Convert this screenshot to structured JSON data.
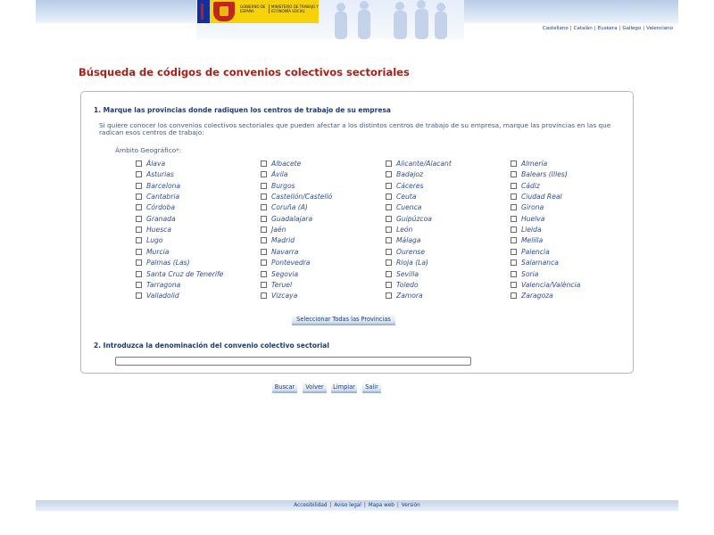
{
  "header": {
    "logo_gobierno": "GOBIERNO DE ESPAÑA",
    "logo_ministerio": "MINISTERIO DE TRABAJO Y ECONOMÍA SOCIAL",
    "languages": [
      "Castellano",
      "Catalán",
      "Euskera",
      "Gallego",
      "Valenciano"
    ]
  },
  "page_title": "Búsqueda de códigos de convenios colectivos sectoriales",
  "section1": {
    "heading": "1. Marque las provincias donde radiquen los centros de trabajo de su empresa",
    "intro": "Si quiere conocer los convenios colectivos sectoriales que pueden afectar a los distintos centros de trabajo de su empresa, marque las provincias en las que radican esos centros de trabajo:",
    "ambito_label": "Ámbito Geográfico*:",
    "provinces": [
      [
        "Álava",
        "Albacete",
        "Alicante/Alacant",
        "Almería"
      ],
      [
        "Asturias",
        "Ávila",
        "Badajoz",
        "Balears (Illes)"
      ],
      [
        "Barcelona",
        "Burgos",
        "Cáceres",
        "Cádiz"
      ],
      [
        "Cantabria",
        "Castellón/Castelló",
        "Ceuta",
        "Ciudad Real"
      ],
      [
        "Córdoba",
        "Coruña (A)",
        "Cuenca",
        "Girona"
      ],
      [
        "Granada",
        "Guadalajara",
        "Guipúzcoa",
        "Huelva"
      ],
      [
        "Huesca",
        "Jaén",
        "León",
        "Lleida"
      ],
      [
        "Lugo",
        "Madrid",
        "Málaga",
        "Melilla"
      ],
      [
        "Murcia",
        "Navarra",
        "Ourense",
        "Palencia"
      ],
      [
        "Palmas (Las)",
        "Pontevedra",
        "Rioja (La)",
        "Salamanca"
      ],
      [
        "Santa Cruz de Tenerife",
        "Segovia",
        "Sevilla",
        "Soria"
      ],
      [
        "Tarragona",
        "Teruel",
        "Toledo",
        "Valencia/València"
      ],
      [
        "Valladolid",
        "Vizcaya",
        "Zamora",
        "Zaragoza"
      ]
    ],
    "select_all_label": "Seleccionar Todas las Provincias"
  },
  "section2": {
    "heading": "2. Introduzca la denominación del convenio colectivo sectorial",
    "input_value": ""
  },
  "actions": {
    "buscar": "Buscar",
    "volver": "Volver",
    "limpiar": "Limpiar",
    "salir": "Salir"
  },
  "footer": {
    "links": [
      "Accesibilidad",
      "Aviso legal",
      "Mapa web",
      "Versión"
    ]
  },
  "colors": {
    "title_red": "#b01d12",
    "link_blue": "#2f4f9c",
    "heading_blue": "#1a3d7a"
  }
}
